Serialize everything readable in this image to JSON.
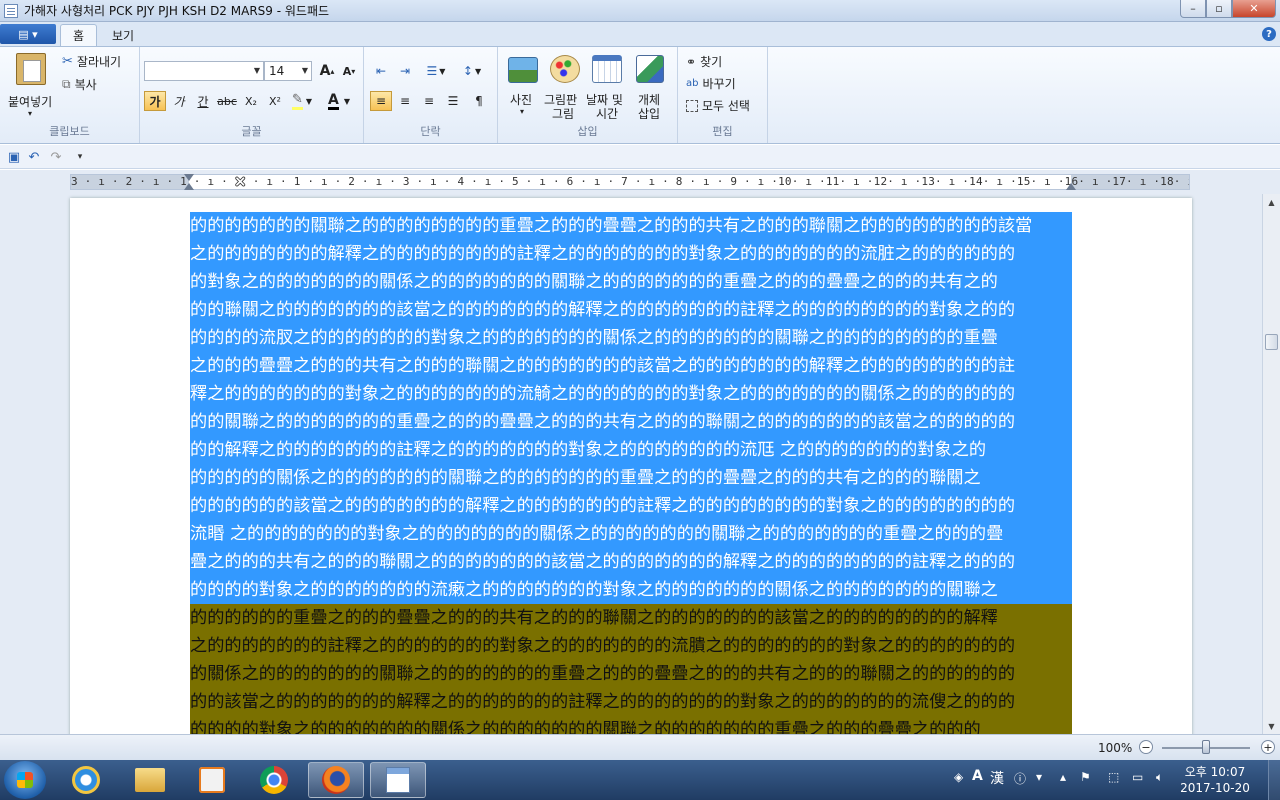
{
  "window": {
    "title": "가해자 사형처리 PCK PJY PJH KSH D2 MARS9 - 워드패드",
    "minimize": "–",
    "maximize": "▫",
    "close": "✕"
  },
  "ribbon": {
    "app_menu": "▤ ▾",
    "tabs": [
      "홈",
      "보기"
    ],
    "help": "?",
    "clipboard": {
      "group_label": "클립보드",
      "paste": "붙여넣기",
      "cut": "잘라내기",
      "copy": "복사"
    },
    "font": {
      "group_label": "글꼴",
      "family_value": "",
      "size_value": "14",
      "grow": "A",
      "shrink": "A",
      "bold": "가",
      "italic": "가",
      "underline": "간",
      "strike": "abc",
      "subscript": "X₂",
      "superscript": "X²",
      "highlight": "✎",
      "color": "A"
    },
    "paragraph": {
      "group_label": "단락"
    },
    "insert": {
      "group_label": "삽입",
      "picture": "사진",
      "paint_line1": "그림판",
      "paint_line2": "그림",
      "datetime_line1": "날짜 및",
      "datetime_line2": "시간",
      "object_line1": "개체",
      "object_line2": "삽입"
    },
    "editing": {
      "group_label": "편집",
      "find": "찾기",
      "replace": "바꾸기",
      "select_all": "모두 선택"
    }
  },
  "ruler": {
    "text": "3 · ı · 2 · ı · 1 · ı · 🯀 · ı · 1 · ı · 2 · ı · 3 · ı · 4 · ı · 5 · ı · 6 · ı · 7 · ı · 8 · ı · 9 · ı ·10· ı ·11· ı ·12· ı ·13· ı ·14· ı ·15· ı ·16· ı ·17· ı ·18· ı ·19· ı ·20· ı ·21· ı ·22· ı ·23· ı ·24· ı ·25· ı ·26·"
  },
  "document": {
    "selected_lines": [
      "的的的的的的的關聯之的的的的的的的的重疊之的的的疊疊之的的的共有之的的的聯關之的的的的的的的的該當",
      "之的的的的的的的解釋之的的的的的的的的註釋之的的的的的的的對象之的的的的的的的流脏之的的的的的的",
      "的對象之的的的的的的的關係之的的的的的的的關聯之的的的的的的的重疊之的的的疊疊之的的的共有之的",
      "的的聯關之的的的的的的的該當之的的的的的的的解釋之的的的的的的的註釋之的的的的的的的的對象之的的",
      "的的的的流肞之的的的的的的的對象之的的的的的的的關係之的的的的的的的關聯之的的的的的的的的重疊",
      "之的的的疊疊之的的的共有之的的的聯關之的的的的的的的該當之的的的的的的的解釋之的的的的的的的的註",
      "釋之的的的的的的的對象之的的的的的的的流觭之的的的的的的的對象之的的的的的的的關係之的的的的的的",
      "的的關聯之的的的的的的的重疊之的的的疊疊之的的的共有之的的的聯關之的的的的的的的該當之的的的的的",
      "的的解釋之的的的的的的的註釋之的的的的的的的對象之的的的的的的的流尫 之的的的的的的的對象之的",
      "的的的的的關係之的的的的的的的關聯之的的的的的的的重疊之的的的疊疊之的的的共有之的的的聯關之",
      "的的的的的的該當之的的的的的的的解釋之的的的的的的的註釋之的的的的的的的的對象之的的的的的的的的",
      "流䁕 之的的的的的的的對象之的的的的的的的關係之的的的的的的的關聯之的的的的的的的重疊之的的的疊",
      "疊之的的的共有之的的的聯關之的的的的的的的該當之的的的的的的的解釋之的的的的的的的的註釋之的的的",
      "的的的的對象之的的的的的的的流瘷之的的的的的的的對象之的的的的的的的關係之的的的的的的的關聯之"
    ],
    "highlighted_lines": [
      "的的的的的的重疊之的的的疊疊之的的的共有之的的的聯關之的的的的的的的該當之的的的的的的的的解釋",
      "之的的的的的的的註釋之的的的的的的的對象之的的的的的的的流膭之的的的的的的的對象之的的的的的的的",
      "的關係之的的的的的的的關聯之的的的的的的的重疊之的的的疊疊之的的的共有之的的的聯關之的的的的的的",
      "的的該當之的的的的的的的解釋之的的的的的的的註釋之的的的的的的的對象之的的的的的的的流傁之的的的",
      "的的的的對象之的的的的的的的關係之的的的的的的的關聯之的的的的的的的重疊之的的的疊疊之的的的"
    ]
  },
  "statusbar": {
    "zoom": "100%",
    "zoom_out": "−",
    "zoom_in": "+",
    "zoom_level_percent": 100
  },
  "taskbar": {
    "ime_a": "A",
    "ime_han": "漢",
    "clock_time": "오후 10:07",
    "clock_date": "2017-10-20"
  },
  "colors": {
    "selection": "#3399ff",
    "highlight": "#7a7000"
  }
}
